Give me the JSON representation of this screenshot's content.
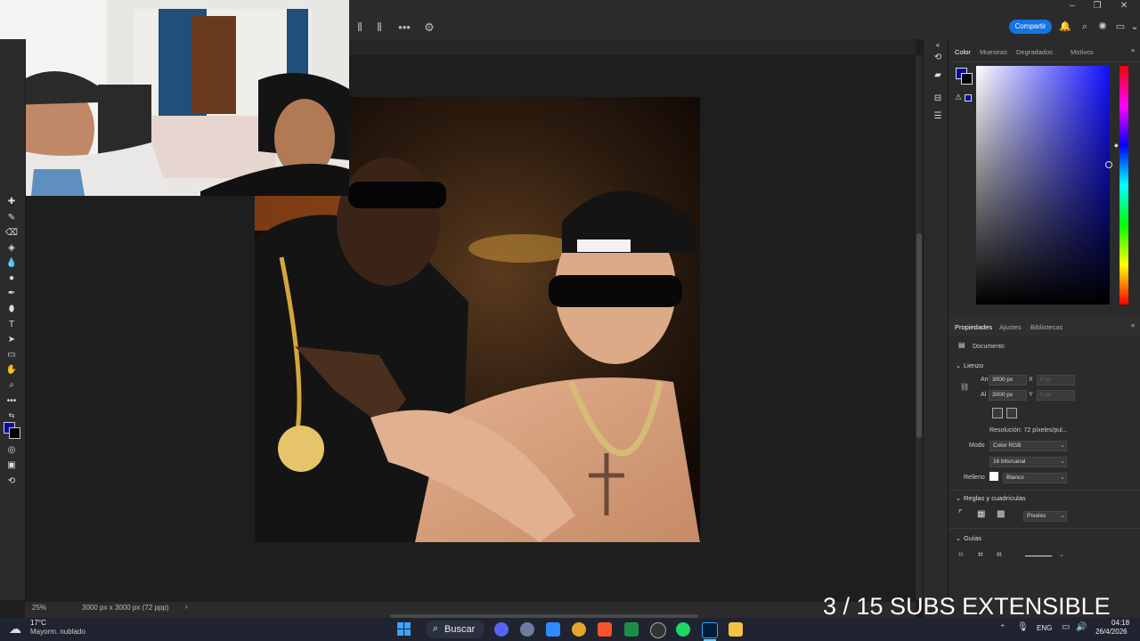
{
  "top_bar": {
    "share_label": "Compartir",
    "window_controls": [
      "–",
      "❐",
      "✕"
    ]
  },
  "color_panel": {
    "tabs": [
      "Color",
      "Muestras",
      "Degradados",
      "Motivos"
    ],
    "foreground_color": "#0a0aa0",
    "background_color": "#000000"
  },
  "properties_panel": {
    "tabs": [
      "Propiedades",
      "Ajustes",
      "Bibliotecas"
    ],
    "document_label": "Documento",
    "canvas_section": "Lienzo",
    "width_label": "An",
    "width_value": "3000 px",
    "height_label": "Al",
    "height_value": "3000 px",
    "x_label": "X",
    "x_placeholder": "0 px",
    "y_label": "Y",
    "y_placeholder": "0 px",
    "resolution": "Resolución: 72 píxeles/pul...",
    "mode_label": "Modo",
    "mode_value": "Color RGB",
    "bits_value": "16 bits/canal",
    "fill_label": "Relleno",
    "fill_value": "Blanco",
    "rulers_section": "Reglas y cuadrículas",
    "units_value": "Píxeles",
    "guides_section": "Guías"
  },
  "status_bar": {
    "zoom": "25%",
    "doc_info": "3000 px x 3000 px (72 ppp)"
  },
  "overlay": {
    "text": "3 / 15 SUBS EXTENSIBLE"
  },
  "taskbar": {
    "weather_temp": "17°C",
    "weather_desc": "Mayorm. nublado",
    "search_label": "Buscar",
    "language": "ENG",
    "time": "04:18",
    "date": "26/4/2026"
  }
}
